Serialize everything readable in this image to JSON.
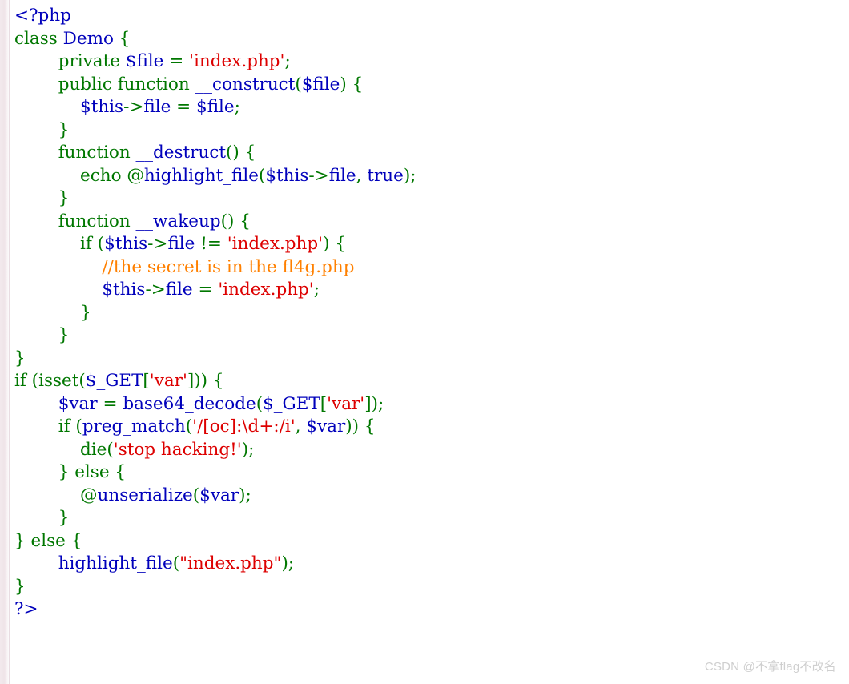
{
  "page": {
    "background_color": "#ffffff",
    "language": "php",
    "rendered_by": "highlight_file"
  },
  "palette": {
    "default": "#0000BB",
    "keyword": "#007700",
    "string": "#DD0000",
    "comment": "#FF8000",
    "variable": "#0000BB",
    "watermark": "#cfcfcf",
    "page_edge": "#f2e9ec"
  },
  "code": {
    "lines": [
      {
        "index": 1,
        "text": "<?php",
        "tokens": [
          {
            "t": "<?php",
            "c": "default"
          }
        ]
      },
      {
        "index": 2,
        "text": "class Demo {",
        "tokens": [
          {
            "t": "class ",
            "c": "keyword"
          },
          {
            "t": "Demo ",
            "c": "default"
          },
          {
            "t": "{",
            "c": "keyword"
          }
        ]
      },
      {
        "index": 3,
        "text": "        private $file = 'index.php';",
        "tokens": [
          {
            "t": "        ",
            "c": "keyword"
          },
          {
            "t": "private ",
            "c": "keyword"
          },
          {
            "t": "$file ",
            "c": "var"
          },
          {
            "t": "= ",
            "c": "keyword"
          },
          {
            "t": "'index.php'",
            "c": "string"
          },
          {
            "t": ";",
            "c": "keyword"
          }
        ]
      },
      {
        "index": 4,
        "text": "        public function __construct($file) {",
        "tokens": [
          {
            "t": "        ",
            "c": "keyword"
          },
          {
            "t": "public function ",
            "c": "keyword"
          },
          {
            "t": "__construct",
            "c": "var"
          },
          {
            "t": "(",
            "c": "keyword"
          },
          {
            "t": "$file",
            "c": "var"
          },
          {
            "t": ") {",
            "c": "keyword"
          }
        ]
      },
      {
        "index": 5,
        "text": "            $this->file = $file;",
        "tokens": [
          {
            "t": "            ",
            "c": "keyword"
          },
          {
            "t": "$this",
            "c": "var"
          },
          {
            "t": "->",
            "c": "keyword"
          },
          {
            "t": "file ",
            "c": "var"
          },
          {
            "t": "= ",
            "c": "keyword"
          },
          {
            "t": "$file",
            "c": "var"
          },
          {
            "t": ";",
            "c": "keyword"
          }
        ]
      },
      {
        "index": 6,
        "text": "        }",
        "tokens": [
          {
            "t": "        }",
            "c": "keyword"
          }
        ]
      },
      {
        "index": 7,
        "text": "        function __destruct() {",
        "tokens": [
          {
            "t": "        ",
            "c": "keyword"
          },
          {
            "t": "function ",
            "c": "keyword"
          },
          {
            "t": "__destruct",
            "c": "var"
          },
          {
            "t": "() {",
            "c": "keyword"
          }
        ]
      },
      {
        "index": 8,
        "text": "            echo @highlight_file($this->file, true);",
        "tokens": [
          {
            "t": "            ",
            "c": "keyword"
          },
          {
            "t": "echo ",
            "c": "keyword"
          },
          {
            "t": "@",
            "c": "keyword"
          },
          {
            "t": "highlight_file",
            "c": "var"
          },
          {
            "t": "(",
            "c": "keyword"
          },
          {
            "t": "$this",
            "c": "var"
          },
          {
            "t": "->",
            "c": "keyword"
          },
          {
            "t": "file",
            "c": "var"
          },
          {
            "t": ", ",
            "c": "keyword"
          },
          {
            "t": "true",
            "c": "var"
          },
          {
            "t": ");",
            "c": "keyword"
          }
        ]
      },
      {
        "index": 9,
        "text": "        }",
        "tokens": [
          {
            "t": "        }",
            "c": "keyword"
          }
        ]
      },
      {
        "index": 10,
        "text": "        function __wakeup() {",
        "tokens": [
          {
            "t": "        ",
            "c": "keyword"
          },
          {
            "t": "function ",
            "c": "keyword"
          },
          {
            "t": "__wakeup",
            "c": "var"
          },
          {
            "t": "() {",
            "c": "keyword"
          }
        ]
      },
      {
        "index": 11,
        "text": "            if ($this->file != 'index.php') {",
        "tokens": [
          {
            "t": "            ",
            "c": "keyword"
          },
          {
            "t": "if ",
            "c": "keyword"
          },
          {
            "t": "(",
            "c": "keyword"
          },
          {
            "t": "$this",
            "c": "var"
          },
          {
            "t": "->",
            "c": "keyword"
          },
          {
            "t": "file ",
            "c": "var"
          },
          {
            "t": "!= ",
            "c": "keyword"
          },
          {
            "t": "'index.php'",
            "c": "string"
          },
          {
            "t": ") {",
            "c": "keyword"
          }
        ]
      },
      {
        "index": 12,
        "text": "                //the secret is in the fl4g.php",
        "tokens": [
          {
            "t": "                ",
            "c": "keyword"
          },
          {
            "t": "//the secret is in the fl4g.php",
            "c": "comment"
          }
        ]
      },
      {
        "index": 13,
        "text": "                $this->file = 'index.php';",
        "tokens": [
          {
            "t": "                ",
            "c": "keyword"
          },
          {
            "t": "$this",
            "c": "var"
          },
          {
            "t": "->",
            "c": "keyword"
          },
          {
            "t": "file ",
            "c": "var"
          },
          {
            "t": "= ",
            "c": "keyword"
          },
          {
            "t": "'index.php'",
            "c": "string"
          },
          {
            "t": ";",
            "c": "keyword"
          }
        ]
      },
      {
        "index": 14,
        "text": "            }",
        "tokens": [
          {
            "t": "            }",
            "c": "keyword"
          }
        ]
      },
      {
        "index": 15,
        "text": "        }",
        "tokens": [
          {
            "t": "        }",
            "c": "keyword"
          }
        ]
      },
      {
        "index": 16,
        "text": "}",
        "tokens": [
          {
            "t": "}",
            "c": "keyword"
          }
        ]
      },
      {
        "index": 17,
        "text": "if (isset($_GET['var'])) {",
        "tokens": [
          {
            "t": "if ",
            "c": "keyword"
          },
          {
            "t": "(",
            "c": "keyword"
          },
          {
            "t": "isset",
            "c": "keyword"
          },
          {
            "t": "(",
            "c": "keyword"
          },
          {
            "t": "$_GET",
            "c": "var"
          },
          {
            "t": "[",
            "c": "keyword"
          },
          {
            "t": "'var'",
            "c": "string"
          },
          {
            "t": "])) {",
            "c": "keyword"
          }
        ]
      },
      {
        "index": 18,
        "text": "        $var = base64_decode($_GET['var']);",
        "tokens": [
          {
            "t": "        ",
            "c": "keyword"
          },
          {
            "t": "$var ",
            "c": "var"
          },
          {
            "t": "= ",
            "c": "keyword"
          },
          {
            "t": "base64_decode",
            "c": "var"
          },
          {
            "t": "(",
            "c": "keyword"
          },
          {
            "t": "$_GET",
            "c": "var"
          },
          {
            "t": "[",
            "c": "keyword"
          },
          {
            "t": "'var'",
            "c": "string"
          },
          {
            "t": "]);",
            "c": "keyword"
          }
        ]
      },
      {
        "index": 19,
        "text": "        if (preg_match('/[oc]:\\d+:/i', $var)) {",
        "tokens": [
          {
            "t": "        ",
            "c": "keyword"
          },
          {
            "t": "if ",
            "c": "keyword"
          },
          {
            "t": "(",
            "c": "keyword"
          },
          {
            "t": "preg_match",
            "c": "var"
          },
          {
            "t": "(",
            "c": "keyword"
          },
          {
            "t": "'/[oc]:\\d+:/i'",
            "c": "string"
          },
          {
            "t": ", ",
            "c": "keyword"
          },
          {
            "t": "$var",
            "c": "var"
          },
          {
            "t": ")) {",
            "c": "keyword"
          }
        ]
      },
      {
        "index": 20,
        "text": "            die('stop hacking!');",
        "tokens": [
          {
            "t": "            ",
            "c": "keyword"
          },
          {
            "t": "die",
            "c": "keyword"
          },
          {
            "t": "(",
            "c": "keyword"
          },
          {
            "t": "'stop hacking!'",
            "c": "string"
          },
          {
            "t": ");",
            "c": "keyword"
          }
        ]
      },
      {
        "index": 21,
        "text": "        } else {",
        "tokens": [
          {
            "t": "        } ",
            "c": "keyword"
          },
          {
            "t": "else ",
            "c": "keyword"
          },
          {
            "t": "{",
            "c": "keyword"
          }
        ]
      },
      {
        "index": 22,
        "text": "            @unserialize($var);",
        "tokens": [
          {
            "t": "            ",
            "c": "keyword"
          },
          {
            "t": "@",
            "c": "keyword"
          },
          {
            "t": "unserialize",
            "c": "var"
          },
          {
            "t": "(",
            "c": "keyword"
          },
          {
            "t": "$var",
            "c": "var"
          },
          {
            "t": ");",
            "c": "keyword"
          }
        ]
      },
      {
        "index": 23,
        "text": "        }",
        "tokens": [
          {
            "t": "        }",
            "c": "keyword"
          }
        ]
      },
      {
        "index": 24,
        "text": "} else {",
        "tokens": [
          {
            "t": "} ",
            "c": "keyword"
          },
          {
            "t": "else ",
            "c": "keyword"
          },
          {
            "t": "{",
            "c": "keyword"
          }
        ]
      },
      {
        "index": 25,
        "text": "        highlight_file(\"index.php\");",
        "tokens": [
          {
            "t": "        ",
            "c": "keyword"
          },
          {
            "t": "highlight_file",
            "c": "var"
          },
          {
            "t": "(",
            "c": "keyword"
          },
          {
            "t": "\"index.php\"",
            "c": "string"
          },
          {
            "t": ");",
            "c": "keyword"
          }
        ]
      },
      {
        "index": 26,
        "text": "}",
        "tokens": [
          {
            "t": "}",
            "c": "keyword"
          }
        ]
      },
      {
        "index": 27,
        "text": "?>",
        "tokens": [
          {
            "t": "?>",
            "c": "default"
          }
        ]
      }
    ]
  },
  "watermark": {
    "text": "CSDN @不拿flag不改名"
  }
}
